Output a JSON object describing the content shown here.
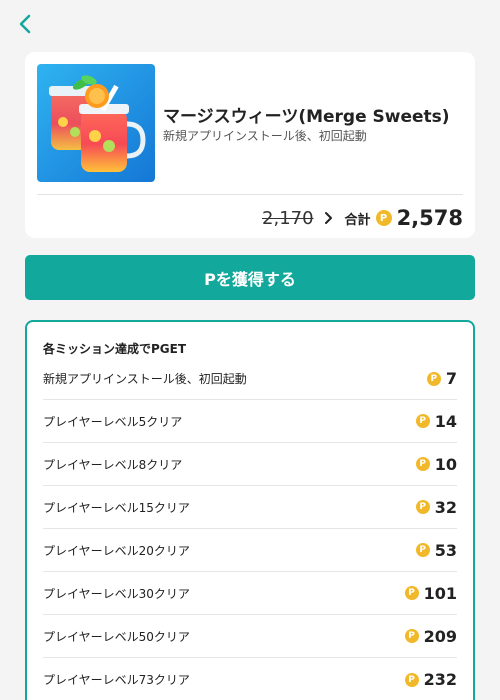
{
  "header": {
    "back_icon": "chevron-left-icon",
    "accent_color": "#13a89c"
  },
  "app": {
    "title": "マージスウィーツ(Merge Sweets)",
    "subtitle": "新規アプリインストール後、初回起動",
    "icon": "merge-sweets-app-icon"
  },
  "pricing": {
    "old_price": "2,170",
    "total_label": "合計",
    "coin_symbol": "P",
    "total_value": "2,578"
  },
  "cta": {
    "label": "Pを獲得する"
  },
  "missions": {
    "heading": "各ミッション達成でPGET",
    "items": [
      {
        "label": "新規アプリインストール後、初回起動",
        "points": "7"
      },
      {
        "label": "プレイヤーレベル5クリア",
        "points": "14"
      },
      {
        "label": "プレイヤーレベル8クリア",
        "points": "10"
      },
      {
        "label": "プレイヤーレベル15クリア",
        "points": "32"
      },
      {
        "label": "プレイヤーレベル20クリア",
        "points": "53"
      },
      {
        "label": "プレイヤーレベル30クリア",
        "points": "101"
      },
      {
        "label": "プレイヤーレベル50クリア",
        "points": "209"
      },
      {
        "label": "プレイヤーレベル73クリア",
        "points": "232"
      }
    ]
  },
  "colors": {
    "teal": "#13a89c",
    "coin": "#f1b92a",
    "background": "#f4f4f4"
  }
}
